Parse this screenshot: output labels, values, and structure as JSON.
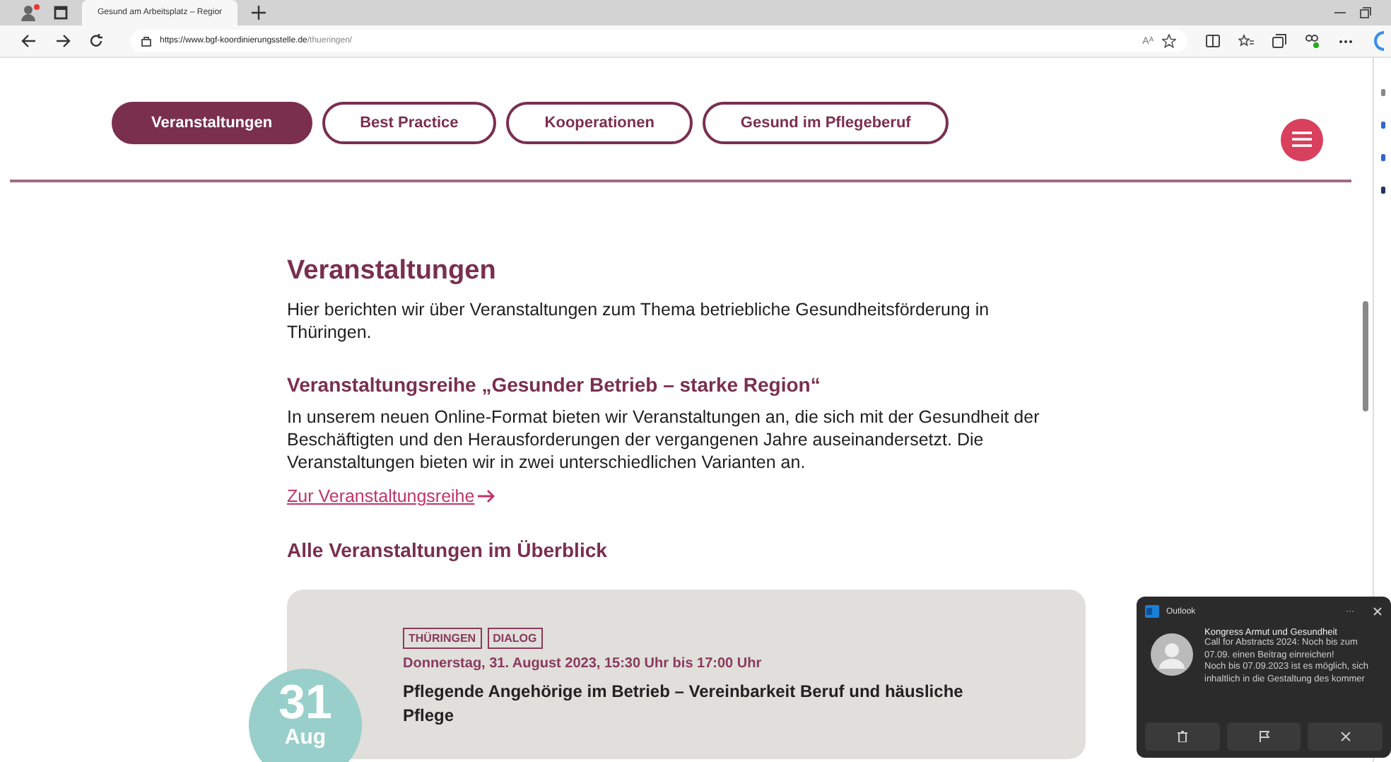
{
  "browser": {
    "tab_title": "Gesund am Arbeitsplatz – Regior",
    "url_host": "https://www.bgf-koordinierungsstelle.de",
    "url_path": "/thueringen/",
    "read_aloud": "Aᴬ"
  },
  "nav": [
    {
      "label": "Veranstaltungen",
      "selected": true
    },
    {
      "label": "Best Practice",
      "selected": false
    },
    {
      "label": "Kooperationen",
      "selected": false
    },
    {
      "label": "Gesund im Pflegeberuf",
      "selected": false
    }
  ],
  "content": {
    "heading": "Veranstaltungen",
    "intro": "Hier berichten wir über Veranstaltungen zum Thema betriebliche Gesundheitsförderung in Thüringen.",
    "series_heading": "Veranstaltungsreihe „Gesunder Betrieb – starke Region“",
    "series_text": "In unserem neuen Online-Format bieten wir Veranstaltungen an, die sich mit der Gesundheit der Beschäftigten und den Herausforderungen der vergangenen Jahre auseinandersetzt. Die Veranstaltungen bieten wir in zwei unterschiedlichen Varianten an.",
    "series_link": "Zur Veranstaltungsreihe",
    "overview_heading": "Alle Veranstaltungen im Überblick"
  },
  "events": [
    {
      "day": "31",
      "month": "Aug",
      "tags": [
        "THÜRINGEN",
        "DIALOG"
      ],
      "date": "Donnerstag, 31. August 2023, 15:30 Uhr bis 17:00 Uhr",
      "title": "Pflegende Angehörige im Betrieb – Vereinbarkeit Beruf und häusliche Pflege"
    }
  ],
  "notification": {
    "app": "Outlook",
    "more": "···",
    "title": "Kongress Armut und Gesundheit",
    "lines": [
      "Call for Abstracts 2024: Noch bis zum 07.09. einen Beitrag einreichen!",
      "Noch bis 07.09.2023 ist es möglich, sich inhaltlich in die Gestaltung des kommer"
    ]
  }
}
